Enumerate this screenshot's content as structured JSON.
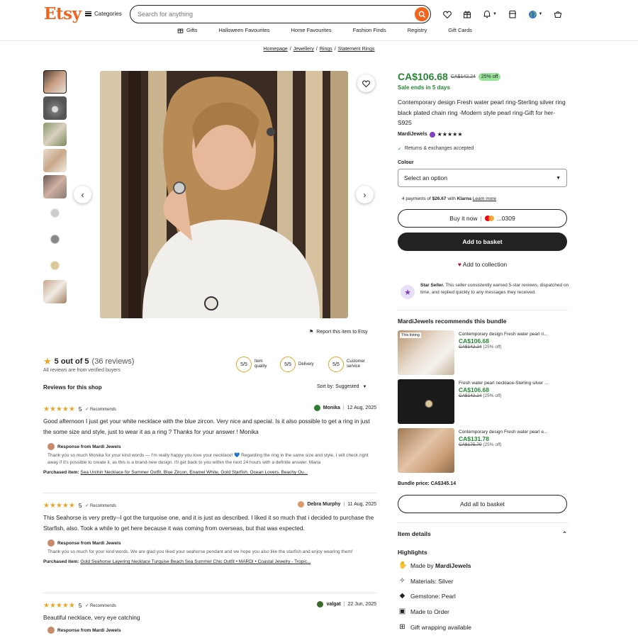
{
  "header": {
    "logo": "Etsy",
    "categories_label": "Categories",
    "search_placeholder": "Search for anything",
    "nav": [
      "Gifts",
      "Halloween Favourites",
      "Home Favourites",
      "Fashion Finds",
      "Registry",
      "Gift Cards"
    ],
    "icons": [
      "heart-icon",
      "gift-icon",
      "bell-icon",
      "shop-icon",
      "globe-icon",
      "basket-icon"
    ]
  },
  "breadcrumb": [
    "Homepage",
    "Jewellery",
    "Rings",
    "Statement Rings"
  ],
  "gallery": {
    "thumb_count": 9,
    "report_label": "Report this item to Etsy"
  },
  "listing": {
    "price": "CA$106.68",
    "original_price": "CA$142.24",
    "discount": "25% off",
    "sale_ends": "Sale ends in 5 days",
    "title": "Contemporary design Fresh water pearl ring-Sterling silver ring black plated chain ring -Modern style pearl ring-Gift for her-S925",
    "seller": "MardiJewels",
    "seller_stars": "★★★★★",
    "returns": "Returns & exchanges accepted",
    "colour_label": "Colour",
    "colour_select": "Select an option",
    "klarna_prefix": "4 payments of",
    "klarna_amount": "$26.67",
    "klarna_with": "with",
    "klarna_brand": "Klarna",
    "klarna_link": "Learn more",
    "buy_now": "Buy it now",
    "card_suffix": "...0309",
    "add_basket": "Add to basket",
    "add_collection": "Add to collection",
    "star_seller_title": "Star Seller.",
    "star_seller_text": "This seller consistently earned 5-star reviews, dispatched on time, and replied quickly to any messages they received."
  },
  "bundle": {
    "heading": "MardiJewels recommends this bundle",
    "this_listing_tag": "This listing",
    "items": [
      {
        "title": "Contemporary design Fresh water pearl ri...",
        "price": "CA$106.68",
        "original": "CA$142.24",
        "discount": "(25% off)"
      },
      {
        "title": "Fresh water pearl necklace-Sterling silver ...",
        "price": "CA$106.68",
        "original": "CA$142.24",
        "discount": "(25% off)"
      },
      {
        "title": "Contemporary design Fresh water pearl e...",
        "price": "CA$131.78",
        "original": "CA$175.70",
        "discount": "(25% off)"
      }
    ],
    "bundle_price": "Bundle price: CA$345.14",
    "add_all": "Add all to basket"
  },
  "item_details": {
    "heading": "Item details",
    "highlights_heading": "Highlights",
    "made_by_prefix": "Made by",
    "made_by_shop": "MardiJewels",
    "materials": "Materials: Silver",
    "gemstone": "Gemstone: Pearl",
    "made_to_order": "Made to Order",
    "gift_wrapping": "Gift wrapping available"
  },
  "reviews": {
    "rating_text": "5 out of 5",
    "count_text": "(36 reviews)",
    "verified": "All reviews are from verified buyers",
    "badges": [
      {
        "score": "5/5",
        "label": "Item quality"
      },
      {
        "score": "5/5",
        "label": "Delivery"
      },
      {
        "score": "5/5",
        "label": "Customer service"
      }
    ],
    "section_title": "Reviews for this shop",
    "sort_label": "Sort by: Suggested",
    "items": [
      {
        "stars": "★★★★★",
        "rating": "5",
        "recommends": "✓ Recommends",
        "user": "Monika",
        "date": "12 Aug, 2025",
        "text": "Good afternoon I just get your white necklace with the blue zircon. Very nice and special. Is it also possible to get a ring in just the some size and style, just to wear it as a ring ? Thanks for your answer ! Monika",
        "response_title": "Response from Mardi Jewels",
        "response_text": "Thank you so much Monika for your kind words — I'm really happy you love your necklace! 💙 Regarding the ring in the same size and style, I will check right away if it's possible to create it, as this is a brand-new design. I'll get back to you within the next 24 hours with a definite answer. Maria",
        "purchased_label": "Purchased item:",
        "purchased_item": "Sea Urchin Necklace for Summer Outfit, Blue Zircon, Enamel White, Gold Starfish, Ocean Lovers, Beachy Ou..."
      },
      {
        "stars": "★★★★★",
        "rating": "5",
        "recommends": "✓ Recommends",
        "user": "Debra Murphy",
        "date": "11 Aug, 2025",
        "text": "This Seahorse is very pretty--I got the turquoise one, and it is just as described. I liked it so much that i decided to purchase the Starfish, also. Took a while to get here because it was coming from overseas, but that was expected.",
        "response_title": "Response from Mardi Jewels",
        "response_text": "Thank you so much for your kind words. We are glad you liked your seahorse pendant and we hope you also like the starfish and enjoy wearing them!",
        "purchased_label": "Purchased item:",
        "purchased_item": "Gold Seahorse Layering Necklace Turquise Beach Sea Summer Chic Outfit • MARDI • Coastal Jewelry - Tropic..."
      },
      {
        "stars": "★★★★★",
        "rating": "5",
        "recommends": "✓ Recommends",
        "user": "valgat",
        "date": "22 Jun, 2025",
        "text": "Beautiful necklace, very eye catching",
        "response_title": "Response from Mardi Jewels"
      }
    ]
  },
  "colors": {
    "brand": "#f1641e",
    "sale_green": "#258635",
    "star": "#e8a628",
    "button_dark": "#222222"
  }
}
